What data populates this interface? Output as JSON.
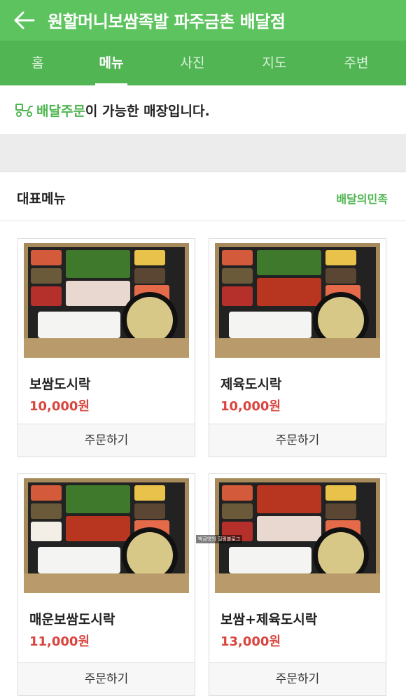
{
  "header": {
    "title": "원할머니보쌈족발 파주금촌 배달점"
  },
  "tabs": [
    {
      "label": "홈"
    },
    {
      "label": "메뉴",
      "active": true
    },
    {
      "label": "사진"
    },
    {
      "label": "지도"
    },
    {
      "label": "주변"
    }
  ],
  "notice": {
    "highlight": "배달주문",
    "rest": "이 가능한 매장입니다."
  },
  "section": {
    "title": "대표메뉴",
    "link": "배달의민족"
  },
  "menu": [
    {
      "name": "보쌈도시락",
      "price": "10,000원",
      "order": "주문하기"
    },
    {
      "name": "제육도시락",
      "price": "10,000원",
      "order": "주문하기"
    },
    {
      "name": "매운보쌈도시락",
      "price": "11,000원",
      "order": "주문하기"
    },
    {
      "name": "보쌈+제육도시락",
      "price": "13,000원",
      "order": "주문하기"
    }
  ],
  "watermark": "박금영의 힐링블로그",
  "colors": {
    "brand": "#5cc35e",
    "tab_bg": "#52b554",
    "price": "#d9453e",
    "link": "#4fb550"
  }
}
